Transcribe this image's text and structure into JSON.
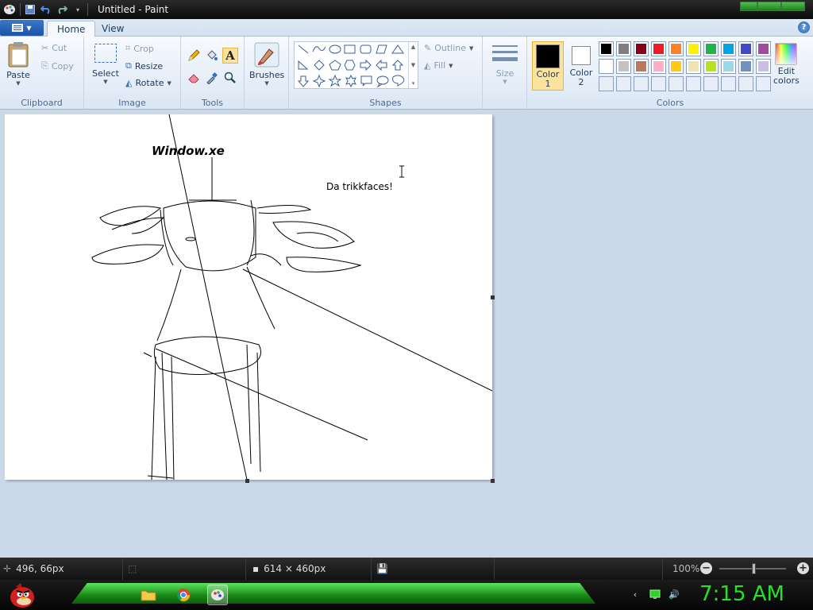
{
  "window": {
    "title": "Untitled - Paint"
  },
  "tabs": [
    {
      "label": "Home"
    },
    {
      "label": "View"
    }
  ],
  "clipboard": {
    "paste": "Paste",
    "cut": "Cut",
    "copy": "Copy",
    "group": "Clipboard"
  },
  "image": {
    "select": "Select",
    "crop": "Crop",
    "resize": "Resize",
    "rotate": "Rotate",
    "group": "Image"
  },
  "tools": {
    "group": "Tools"
  },
  "brushes": {
    "label": "Brushes"
  },
  "shapes": {
    "outline": "Outline",
    "fill": "Fill",
    "group": "Shapes"
  },
  "size": {
    "label": "Size"
  },
  "colors": {
    "color1_line1": "Color",
    "color1_line2": "1",
    "color2_line1": "Color",
    "color2_line2": "2",
    "edit_line1": "Edit",
    "edit_line2": "colors",
    "group": "Colors",
    "color1": "#000000",
    "color2": "#ffffff",
    "row1": [
      "#000000",
      "#7f7f7f",
      "#880015",
      "#ed1c24",
      "#ff7f27",
      "#fff200",
      "#22b14c",
      "#00a2e8",
      "#3f48cc",
      "#a349a4"
    ],
    "row2": [
      "#ffffff",
      "#c3c3c3",
      "#b97a57",
      "#ffaec9",
      "#ffc90e",
      "#efe4b0",
      "#b5e61d",
      "#99d9ea",
      "#7092be",
      "#c8bfe7"
    ]
  },
  "canvas": {
    "text_title": "Window.xe",
    "text_label": "Da trikkfaces!"
  },
  "status": {
    "coords": "496, 66px",
    "dimensions": "614 × 460px",
    "zoom": "100%"
  },
  "taskbar": {
    "clock": "7:15 AM"
  }
}
